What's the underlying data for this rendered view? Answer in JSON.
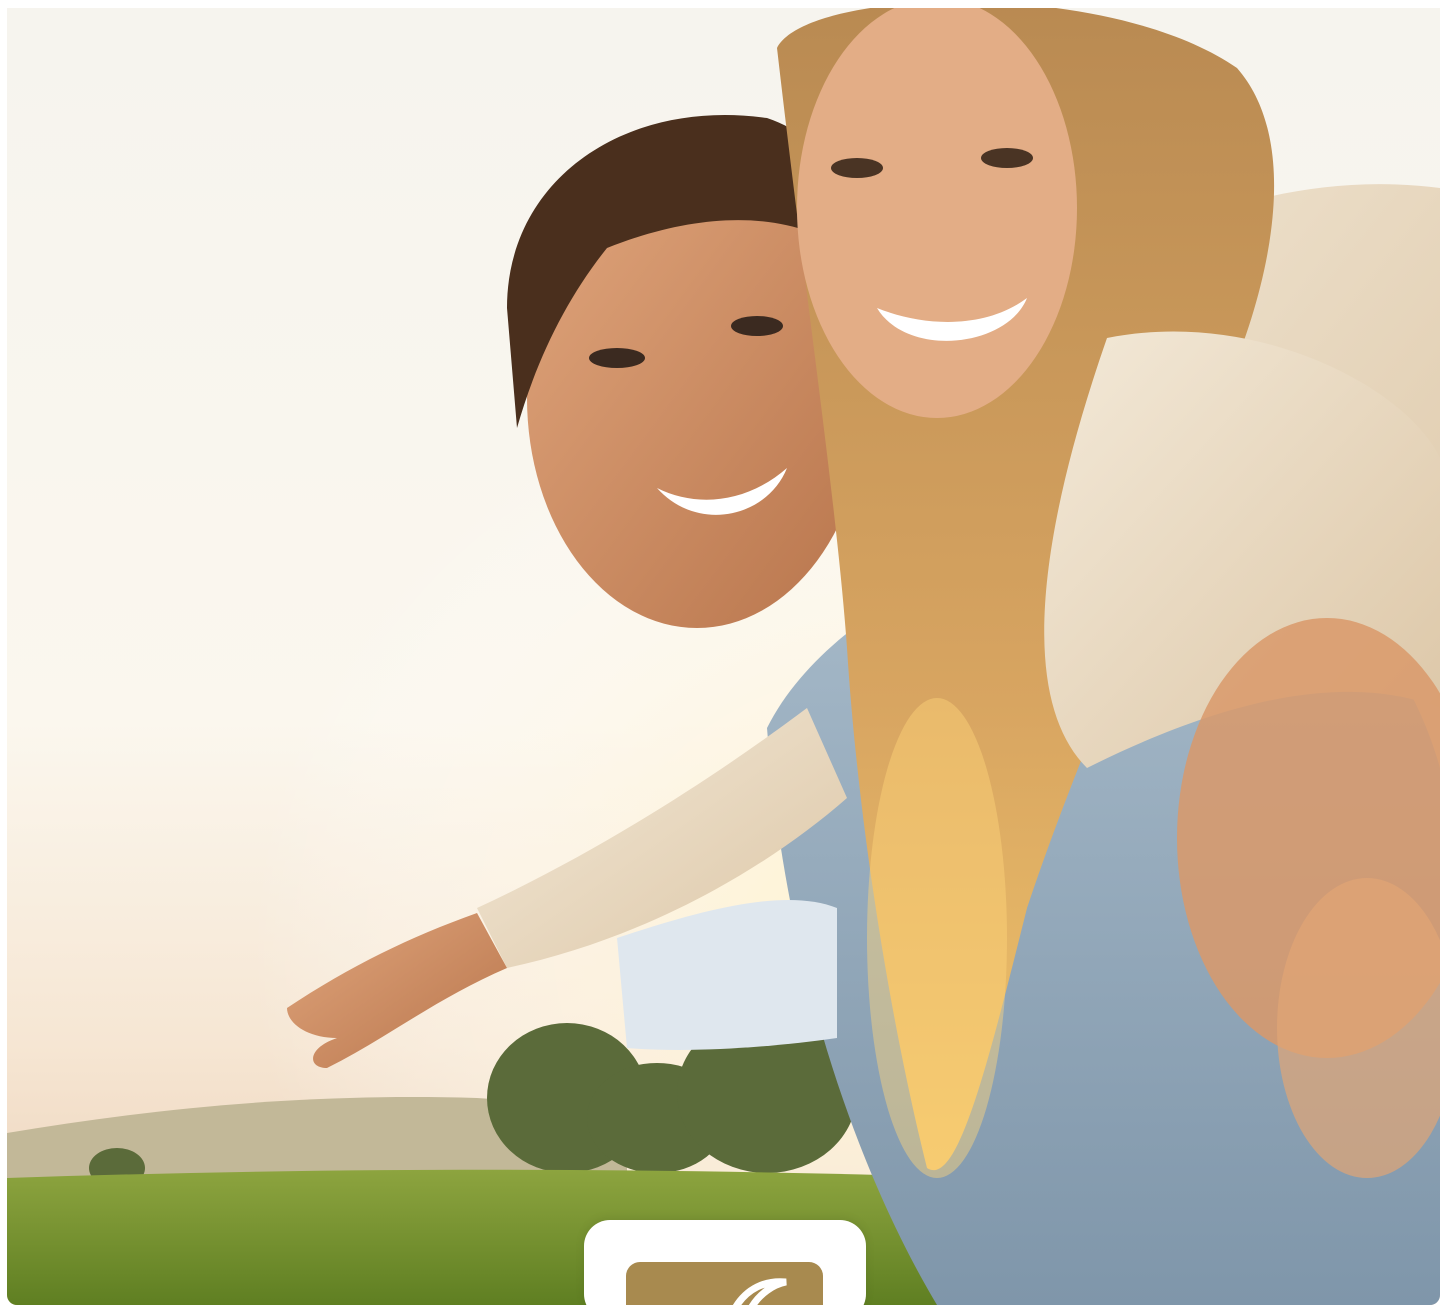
{
  "hero": {
    "image": "couple-piggyback-sunset-photo",
    "colors": {
      "sky": "#f4f1ea",
      "sun_glow": "#fff6dc",
      "grass": "#6f8f2c",
      "hill": "#b9b08a",
      "sweater": "#efe3cf",
      "denim": "#93a9bb",
      "skin": "#c98b62",
      "hair_man": "#4a2f1d",
      "hair_woman": "#c89a5e"
    }
  },
  "brand": {
    "logo_icon": "swoosh-logo-icon",
    "tile_color": "#a88a4f"
  }
}
